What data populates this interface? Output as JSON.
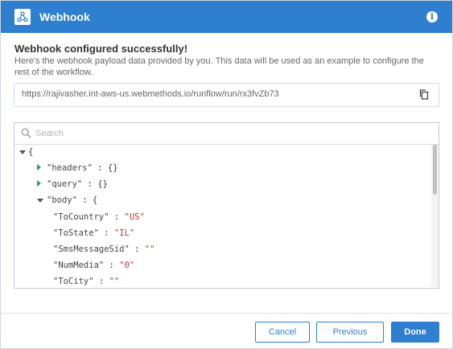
{
  "dialog": {
    "title": "Webhook",
    "success_message": "Webhook configured successfully!",
    "description": "Here's the webhook payload data provided by you. This data will be used as an example to configure the rest of the workflow.",
    "webhook_url": "https://rajivasher.int-aws-us.webmethods.io/runflow/run/rx3fvZb73"
  },
  "search": {
    "placeholder": "Search",
    "value": ""
  },
  "tree": {
    "root_open": "{",
    "headers": {
      "key": "\"headers\"",
      "colon": ":",
      "value": "{}"
    },
    "query": {
      "key": "\"query\"",
      "colon": ":",
      "value": "{}"
    },
    "body": {
      "key": "\"body\"",
      "colon": ":",
      "open": "{"
    },
    "fields": [
      {
        "key": "\"ToCountry\"",
        "value": "\"US\""
      },
      {
        "key": "\"ToState\"",
        "value": "\"IL\""
      },
      {
        "key": "\"SmsMessageSid\"",
        "value": "\"\""
      },
      {
        "key": "\"NumMedia\"",
        "value": "\"0\""
      },
      {
        "key": "\"ToCity\"",
        "value": "\"\""
      }
    ]
  },
  "buttons": {
    "cancel": "Cancel",
    "previous": "Previous",
    "done": "Done"
  },
  "colors": {
    "header_bg": "#2f7fd0",
    "accent": "#2f7fd0",
    "value_text": "#c0392b",
    "collapsed_toggle": "#1a9e8f"
  },
  "icons": {
    "logo": "webhook-icon",
    "info": "info-icon",
    "copy": "copy-icon",
    "search": "search-icon"
  }
}
